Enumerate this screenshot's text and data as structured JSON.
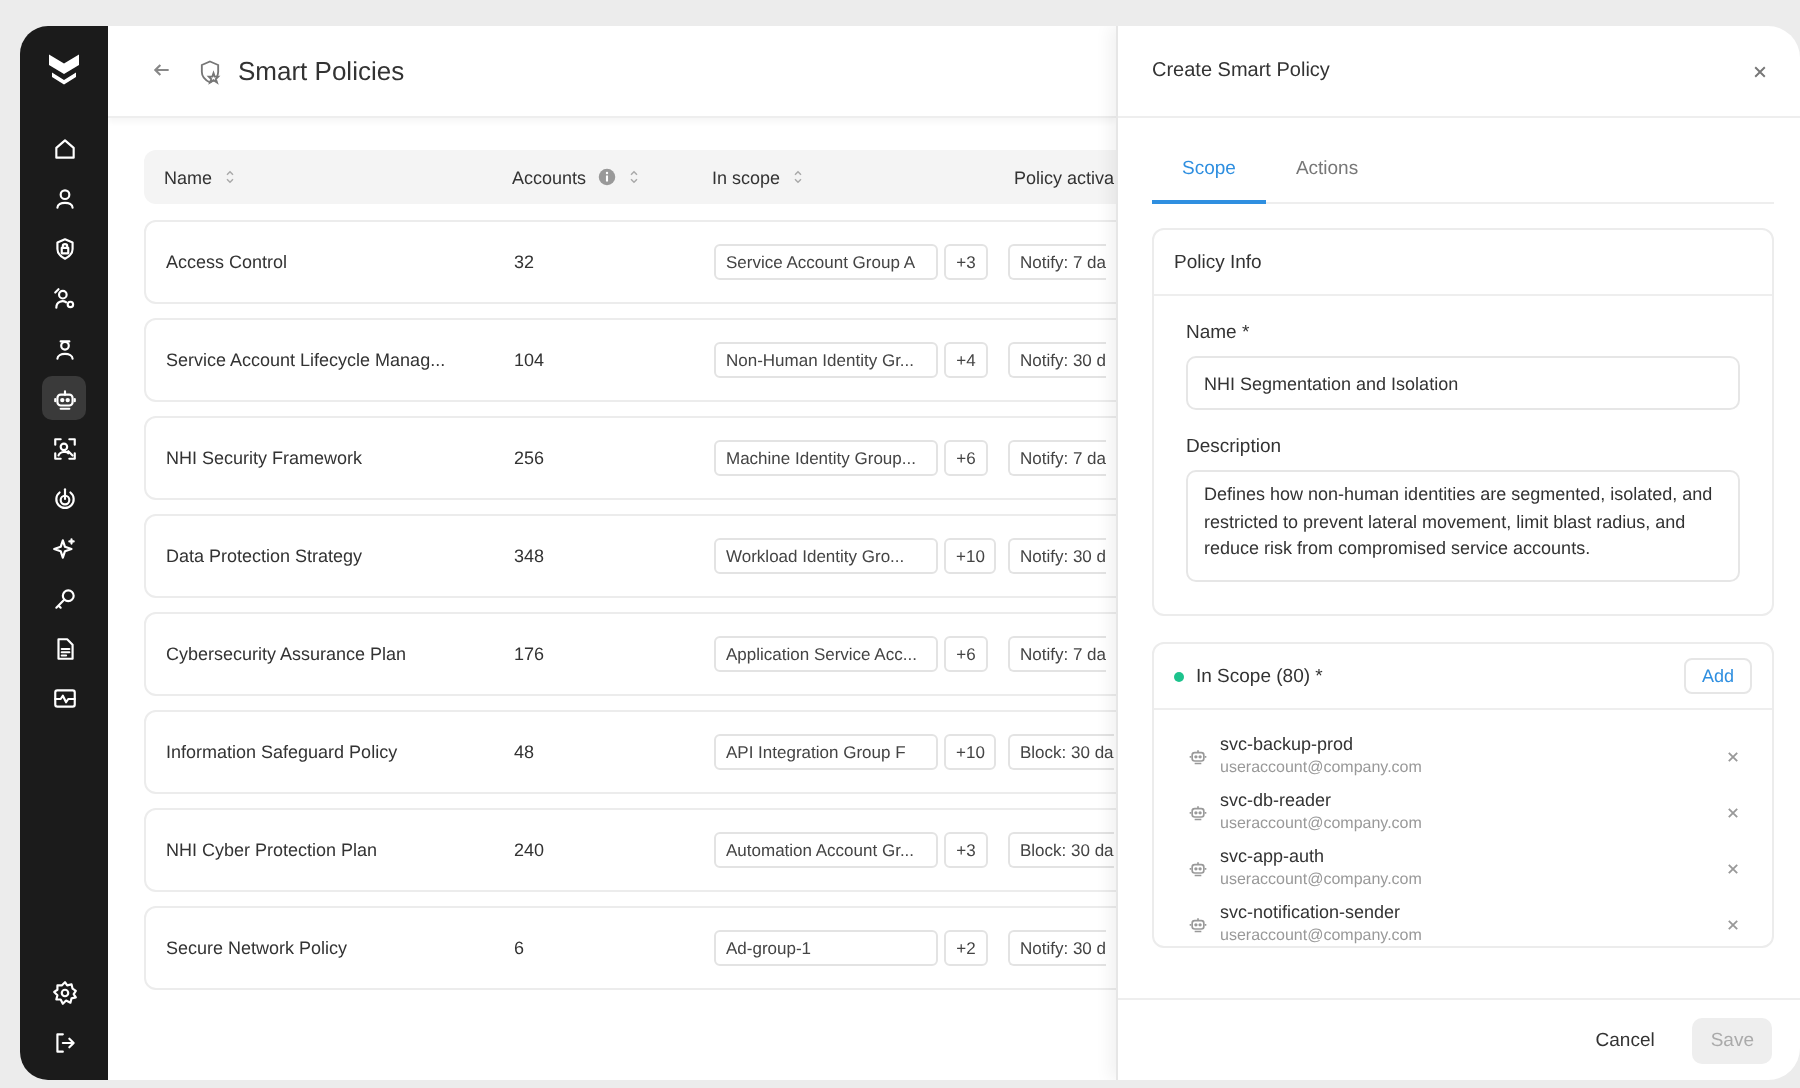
{
  "sidebar": {
    "items": [
      {
        "kind": "home",
        "selected": false
      },
      {
        "kind": "user",
        "selected": false
      },
      {
        "kind": "shield-lock",
        "selected": false
      },
      {
        "kind": "user-key",
        "selected": false
      },
      {
        "kind": "user-badge",
        "selected": false
      },
      {
        "kind": "robot",
        "selected": true
      },
      {
        "kind": "scan-user",
        "selected": false
      },
      {
        "kind": "power",
        "selected": false
      },
      {
        "kind": "sparkles",
        "selected": false
      },
      {
        "kind": "key",
        "selected": false
      },
      {
        "kind": "document",
        "selected": false
      },
      {
        "kind": "monitor-pulse",
        "selected": false
      }
    ],
    "bottom_items": [
      {
        "kind": "gear",
        "selected": false
      },
      {
        "kind": "logout",
        "selected": false
      }
    ]
  },
  "page": {
    "title": "Smart Policies"
  },
  "table": {
    "columns": [
      {
        "label": "Name",
        "sortable": true,
        "info": false
      },
      {
        "label": "Accounts",
        "sortable": true,
        "info": true
      },
      {
        "label": "In scope",
        "sortable": true,
        "info": false
      },
      {
        "label": "Policy activa",
        "sortable": false,
        "info": false
      }
    ],
    "rows": [
      {
        "name": "Access Control",
        "accounts": "32",
        "scope": "Service Account Group A",
        "scope_more": "+3",
        "activation": "Notify: 7 da"
      },
      {
        "name": "Service Account Lifecycle Manag...",
        "accounts": "104",
        "scope": "Non-Human Identity Gr...",
        "scope_more": "+4",
        "activation": "Notify: 30 d"
      },
      {
        "name": "NHI Security Framework",
        "accounts": "256",
        "scope": "Machine Identity Group...",
        "scope_more": "+6",
        "activation": "Notify: 7 da"
      },
      {
        "name": "Data Protection Strategy",
        "accounts": "348",
        "scope": "Workload Identity Gro...",
        "scope_more": "+10",
        "activation": "Notify: 30 d"
      },
      {
        "name": "Cybersecurity Assurance Plan",
        "accounts": "176",
        "scope": "Application Service Acc...",
        "scope_more": "+6",
        "activation": "Notify: 7 da"
      },
      {
        "name": "Information Safeguard Policy",
        "accounts": "48",
        "scope": "API Integration Group F",
        "scope_more": "+10",
        "activation": "Block: 30 da"
      },
      {
        "name": "NHI Cyber Protection Plan",
        "accounts": "240",
        "scope": "Automation Account Gr...",
        "scope_more": "+3",
        "activation": "Block: 30 da"
      },
      {
        "name": "Secure Network Policy",
        "accounts": "6",
        "scope": "Ad-group-1",
        "scope_more": "+2",
        "activation": "Notify: 30 d"
      }
    ]
  },
  "drawer": {
    "title": "Create Smart Policy",
    "tabs": [
      {
        "label": "Scope",
        "selected": true
      },
      {
        "label": "Actions",
        "selected": false
      }
    ],
    "policy_info": {
      "title": "Policy Info",
      "name_label": "Name *",
      "name_value": "NHI Segmentation and Isolation",
      "description_label": "Description",
      "description_value": "Defines how non-human identities are segmented, isolated, and restricted to prevent lateral movement, limit blast radius, and reduce risk from compromised service accounts."
    },
    "in_scope": {
      "title": "In Scope (80) *",
      "add_label": "Add",
      "accounts": [
        {
          "name": "svc-backup-prod",
          "email": "useraccount@company.com"
        },
        {
          "name": "svc-db-reader",
          "email": "useraccount@company.com"
        },
        {
          "name": "svc-app-auth",
          "email": "useraccount@company.com"
        },
        {
          "name": "svc-notification-sender",
          "email": "useraccount@company.com"
        }
      ]
    },
    "buttons": [
      {
        "label": "Cancel",
        "kind": "secondary",
        "disabled": false
      },
      {
        "label": "Save",
        "kind": "primary",
        "disabled": true
      }
    ]
  }
}
